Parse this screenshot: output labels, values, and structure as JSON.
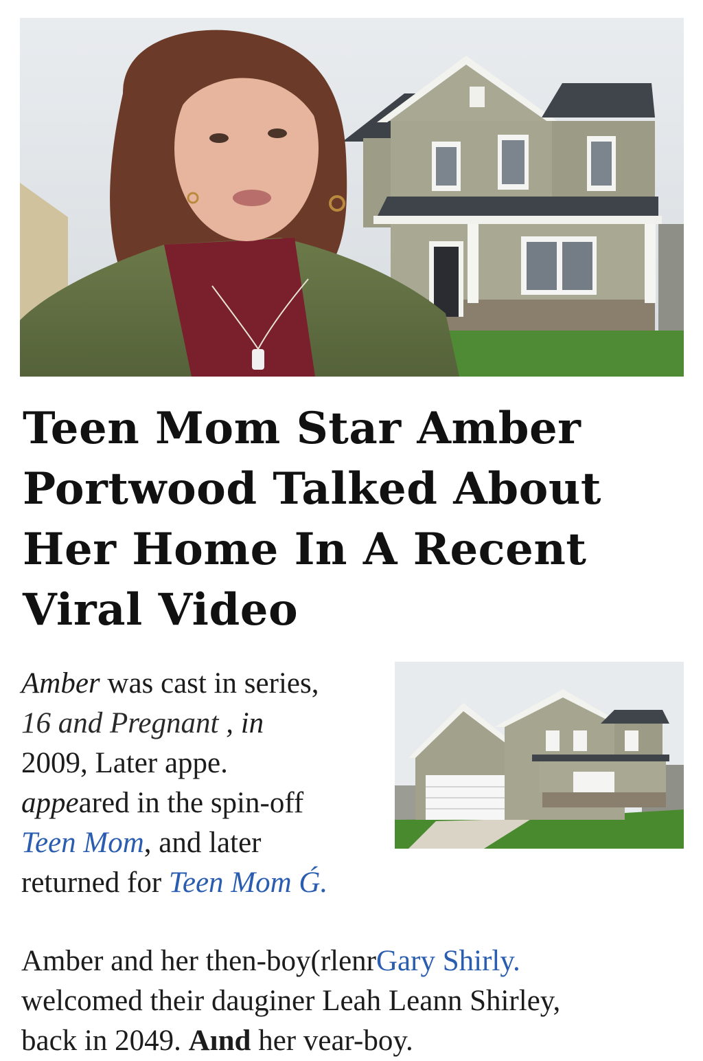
{
  "article": {
    "headline_lines": [
      "Teen Mom Star Amber",
      "Portwood Talked About",
      "Her Home In A Recent",
      "Viral Video"
    ],
    "para1": {
      "l1_a": "Amber",
      "l1_b": " was cast in  series,",
      "l2_a": "16  and Pregnant",
      "l2_b": " , in",
      "l3": "2009, Later appe.",
      "l4_a": "appe",
      "l4_b": "ared in the spin-off",
      "l5_link": "Teen Mom",
      "l5_b": ", and later",
      "l6_a": "returned for ",
      "l6_link": "Teen Mom Ǵ."
    },
    "para2": {
      "l1_a": "Amber and her then-boy(rlenr",
      "l1_link": "Gary  Shirly.",
      "l2": "welcomed their dauginer Leah Leann Shirley,",
      "l3_a": "back in 2049. ",
      "l3_bold": "Aınd",
      "l3_b": " her vear-boy."
    }
  },
  "colors": {
    "link": "#2a5db0",
    "text": "#1c1c1c",
    "headline": "#111111"
  }
}
